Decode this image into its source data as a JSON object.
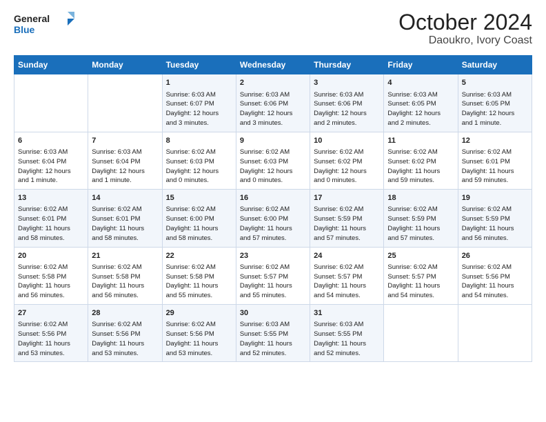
{
  "header": {
    "logo_line1": "General",
    "logo_line2": "Blue",
    "title": "October 2024",
    "subtitle": "Daoukro, Ivory Coast"
  },
  "weekdays": [
    "Sunday",
    "Monday",
    "Tuesday",
    "Wednesday",
    "Thursday",
    "Friday",
    "Saturday"
  ],
  "weeks": [
    [
      {
        "day": null,
        "info": null
      },
      {
        "day": null,
        "info": null
      },
      {
        "day": "1",
        "info": "Sunrise: 6:03 AM\nSunset: 6:07 PM\nDaylight: 12 hours\nand 3 minutes."
      },
      {
        "day": "2",
        "info": "Sunrise: 6:03 AM\nSunset: 6:06 PM\nDaylight: 12 hours\nand 3 minutes."
      },
      {
        "day": "3",
        "info": "Sunrise: 6:03 AM\nSunset: 6:06 PM\nDaylight: 12 hours\nand 2 minutes."
      },
      {
        "day": "4",
        "info": "Sunrise: 6:03 AM\nSunset: 6:05 PM\nDaylight: 12 hours\nand 2 minutes."
      },
      {
        "day": "5",
        "info": "Sunrise: 6:03 AM\nSunset: 6:05 PM\nDaylight: 12 hours\nand 1 minute."
      }
    ],
    [
      {
        "day": "6",
        "info": "Sunrise: 6:03 AM\nSunset: 6:04 PM\nDaylight: 12 hours\nand 1 minute."
      },
      {
        "day": "7",
        "info": "Sunrise: 6:03 AM\nSunset: 6:04 PM\nDaylight: 12 hours\nand 1 minute."
      },
      {
        "day": "8",
        "info": "Sunrise: 6:02 AM\nSunset: 6:03 PM\nDaylight: 12 hours\nand 0 minutes."
      },
      {
        "day": "9",
        "info": "Sunrise: 6:02 AM\nSunset: 6:03 PM\nDaylight: 12 hours\nand 0 minutes."
      },
      {
        "day": "10",
        "info": "Sunrise: 6:02 AM\nSunset: 6:02 PM\nDaylight: 12 hours\nand 0 minutes."
      },
      {
        "day": "11",
        "info": "Sunrise: 6:02 AM\nSunset: 6:02 PM\nDaylight: 11 hours\nand 59 minutes."
      },
      {
        "day": "12",
        "info": "Sunrise: 6:02 AM\nSunset: 6:01 PM\nDaylight: 11 hours\nand 59 minutes."
      }
    ],
    [
      {
        "day": "13",
        "info": "Sunrise: 6:02 AM\nSunset: 6:01 PM\nDaylight: 11 hours\nand 58 minutes."
      },
      {
        "day": "14",
        "info": "Sunrise: 6:02 AM\nSunset: 6:01 PM\nDaylight: 11 hours\nand 58 minutes."
      },
      {
        "day": "15",
        "info": "Sunrise: 6:02 AM\nSunset: 6:00 PM\nDaylight: 11 hours\nand 58 minutes."
      },
      {
        "day": "16",
        "info": "Sunrise: 6:02 AM\nSunset: 6:00 PM\nDaylight: 11 hours\nand 57 minutes."
      },
      {
        "day": "17",
        "info": "Sunrise: 6:02 AM\nSunset: 5:59 PM\nDaylight: 11 hours\nand 57 minutes."
      },
      {
        "day": "18",
        "info": "Sunrise: 6:02 AM\nSunset: 5:59 PM\nDaylight: 11 hours\nand 57 minutes."
      },
      {
        "day": "19",
        "info": "Sunrise: 6:02 AM\nSunset: 5:59 PM\nDaylight: 11 hours\nand 56 minutes."
      }
    ],
    [
      {
        "day": "20",
        "info": "Sunrise: 6:02 AM\nSunset: 5:58 PM\nDaylight: 11 hours\nand 56 minutes."
      },
      {
        "day": "21",
        "info": "Sunrise: 6:02 AM\nSunset: 5:58 PM\nDaylight: 11 hours\nand 56 minutes."
      },
      {
        "day": "22",
        "info": "Sunrise: 6:02 AM\nSunset: 5:58 PM\nDaylight: 11 hours\nand 55 minutes."
      },
      {
        "day": "23",
        "info": "Sunrise: 6:02 AM\nSunset: 5:57 PM\nDaylight: 11 hours\nand 55 minutes."
      },
      {
        "day": "24",
        "info": "Sunrise: 6:02 AM\nSunset: 5:57 PM\nDaylight: 11 hours\nand 54 minutes."
      },
      {
        "day": "25",
        "info": "Sunrise: 6:02 AM\nSunset: 5:57 PM\nDaylight: 11 hours\nand 54 minutes."
      },
      {
        "day": "26",
        "info": "Sunrise: 6:02 AM\nSunset: 5:56 PM\nDaylight: 11 hours\nand 54 minutes."
      }
    ],
    [
      {
        "day": "27",
        "info": "Sunrise: 6:02 AM\nSunset: 5:56 PM\nDaylight: 11 hours\nand 53 minutes."
      },
      {
        "day": "28",
        "info": "Sunrise: 6:02 AM\nSunset: 5:56 PM\nDaylight: 11 hours\nand 53 minutes."
      },
      {
        "day": "29",
        "info": "Sunrise: 6:02 AM\nSunset: 5:56 PM\nDaylight: 11 hours\nand 53 minutes."
      },
      {
        "day": "30",
        "info": "Sunrise: 6:03 AM\nSunset: 5:55 PM\nDaylight: 11 hours\nand 52 minutes."
      },
      {
        "day": "31",
        "info": "Sunrise: 6:03 AM\nSunset: 5:55 PM\nDaylight: 11 hours\nand 52 minutes."
      },
      {
        "day": null,
        "info": null
      },
      {
        "day": null,
        "info": null
      }
    ]
  ]
}
